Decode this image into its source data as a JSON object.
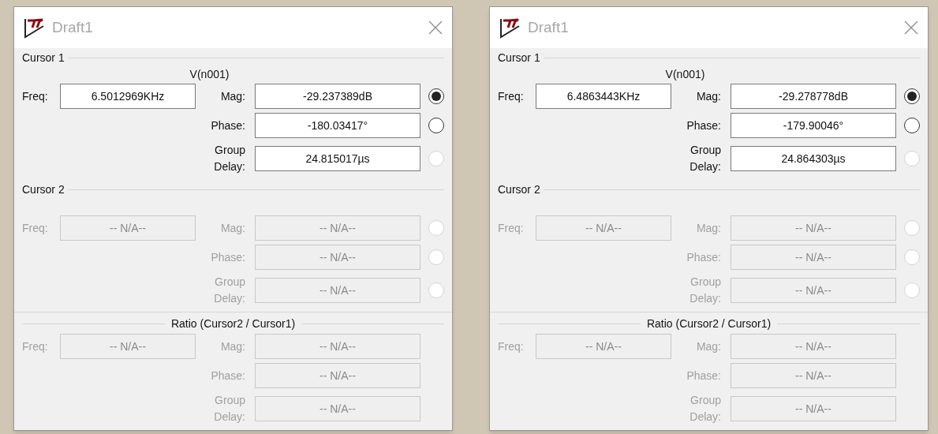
{
  "windows": [
    {
      "title": "Draft1",
      "sections": [
        {
          "kind": "cursor",
          "title": "Cursor 1",
          "trace": "V(n001)",
          "disabled": false,
          "freq_label": "Freq:",
          "freq": "6.5012969KHz",
          "rows": [
            {
              "label": "Mag:",
              "value": "-29.237389dB",
              "radio": {
                "selected": true,
                "disabled": false
              }
            },
            {
              "label": "Phase:",
              "value": "-180.03417°",
              "radio": {
                "selected": false,
                "disabled": false
              }
            },
            {
              "label": "Group Delay:",
              "value": "24.815017µs",
              "radio": {
                "selected": false,
                "disabled": true
              }
            }
          ]
        },
        {
          "kind": "cursor",
          "title": "Cursor 2",
          "disabled": true,
          "freq_label": "Freq:",
          "freq": "-- N/A--",
          "rows": [
            {
              "label": "Mag:",
              "value": "-- N/A--",
              "radio": {
                "selected": false,
                "disabled": true
              }
            },
            {
              "label": "Phase:",
              "value": "-- N/A--",
              "radio": {
                "selected": false,
                "disabled": true
              }
            },
            {
              "label": "Group Delay:",
              "value": "-- N/A--",
              "radio": {
                "selected": false,
                "disabled": true
              }
            }
          ]
        },
        {
          "kind": "ratio",
          "title": "Ratio (Cursor2 / Cursor1)",
          "disabled": true,
          "freq_label": "Freq:",
          "freq": "-- N/A--",
          "rows": [
            {
              "label": "Mag:",
              "value": "-- N/A--"
            },
            {
              "label": "Phase:",
              "value": "-- N/A--"
            },
            {
              "label": "Group Delay:",
              "value": "-- N/A--"
            }
          ]
        }
      ]
    },
    {
      "title": "Draft1",
      "sections": [
        {
          "kind": "cursor",
          "title": "Cursor 1",
          "trace": "V(n001)",
          "disabled": false,
          "freq_label": "Freq:",
          "freq": "6.4863443KHz",
          "rows": [
            {
              "label": "Mag:",
              "value": "-29.278778dB",
              "radio": {
                "selected": true,
                "disabled": false
              }
            },
            {
              "label": "Phase:",
              "value": "-179.90046°",
              "radio": {
                "selected": false,
                "disabled": false
              }
            },
            {
              "label": "Group Delay:",
              "value": "24.864303µs",
              "radio": {
                "selected": false,
                "disabled": true
              }
            }
          ]
        },
        {
          "kind": "cursor",
          "title": "Cursor 2",
          "disabled": true,
          "freq_label": "Freq:",
          "freq": "-- N/A--",
          "rows": [
            {
              "label": "Mag:",
              "value": "-- N/A--",
              "radio": {
                "selected": false,
                "disabled": true
              }
            },
            {
              "label": "Phase:",
              "value": "-- N/A--",
              "radio": {
                "selected": false,
                "disabled": true
              }
            },
            {
              "label": "Group Delay:",
              "value": "-- N/A--",
              "radio": {
                "selected": false,
                "disabled": true
              }
            }
          ]
        },
        {
          "kind": "ratio",
          "title": "Ratio (Cursor2 / Cursor1)",
          "disabled": true,
          "freq_label": "Freq:",
          "freq": "-- N/A--",
          "rows": [
            {
              "label": "Mag:",
              "value": "-- N/A--"
            },
            {
              "label": "Phase:",
              "value": "-- N/A--"
            },
            {
              "label": "Group Delay:",
              "value": "-- N/A--"
            }
          ]
        }
      ]
    }
  ]
}
